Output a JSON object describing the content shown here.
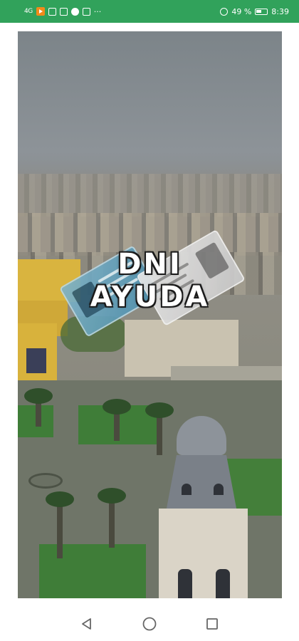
{
  "status_bar": {
    "network_left": "4G",
    "battery_percent": "49 %",
    "time": "8:39",
    "overflow": "···",
    "color": "#31a25b"
  },
  "splash": {
    "title_line1": "DNI",
    "title_line2": "AYUDA"
  },
  "nav_bar": {
    "back_icon": "back-triangle-icon",
    "home_icon": "home-circle-icon",
    "recents_icon": "recents-square-icon"
  }
}
